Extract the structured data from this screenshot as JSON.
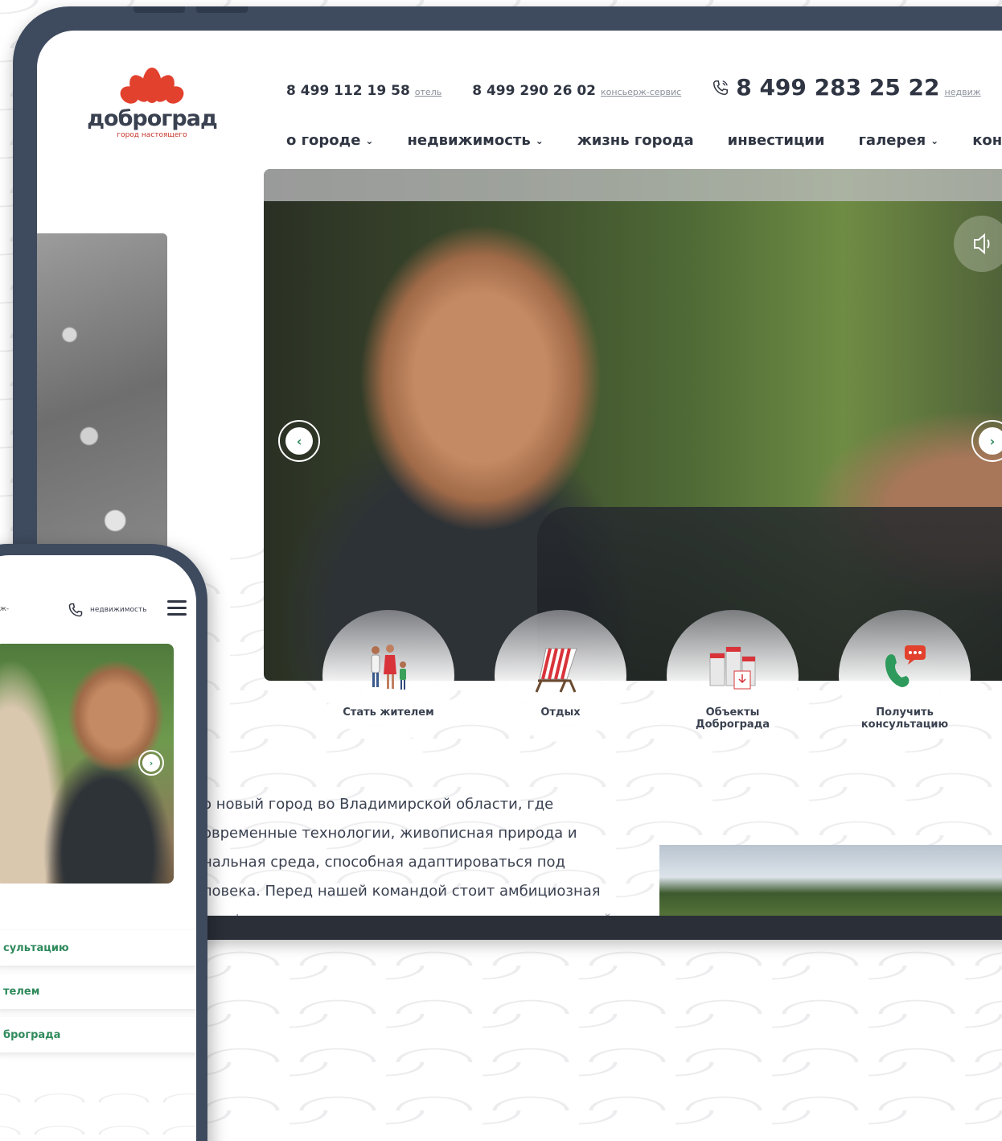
{
  "brand": {
    "name": "доброград",
    "tagline": "город настоящего",
    "accent": "#e2412e",
    "green": "#2f8a5c"
  },
  "header": {
    "phones": [
      {
        "number": "8 499 112 19 58",
        "label": "отель"
      },
      {
        "number": "8 499 290 26 02",
        "label": "консьерж-сервис"
      }
    ],
    "main_phone": {
      "number": "8 499 283 25 22",
      "label": "недвиж",
      "icon": "phone-icon"
    }
  },
  "nav": {
    "items": [
      {
        "label": "о городе",
        "dropdown": true
      },
      {
        "label": "недвижимость",
        "dropdown": true
      },
      {
        "label": "жизнь города",
        "dropdown": false
      },
      {
        "label": "инвестиции",
        "dropdown": false
      },
      {
        "label": "галерея",
        "dropdown": true
      },
      {
        "label": "кон",
        "dropdown": false
      }
    ],
    "chevron": "⌄"
  },
  "hero": {
    "prev_icon": "‹",
    "next_icon": "›",
    "sound_icon": "speaker-icon"
  },
  "quick_links": [
    {
      "label": "Стать жителем",
      "icon": "family-icon"
    },
    {
      "label": "Отдых",
      "icon": "deck-chair-icon"
    },
    {
      "label": "Объекты\nДоброграда",
      "icon": "buildings-icon"
    },
    {
      "label": "Получить\nконсультацию",
      "icon": "phone-chat-icon"
    }
  ],
  "about": {
    "lines": [
      "о новый город во Владимирской области, где",
      "овременные технологии, живописная природа и",
      "нальная среда, способная адаптироваться под",
      "ловека. Перед нашей командой стоит амбициозная",
      "комфортность жизни здесь для всех трех поколений"
    ]
  },
  "mobile": {
    "concierge_label": "рж-",
    "concierge_label2": "",
    "call_label": "недвижимость",
    "next_icon": "›",
    "buttons": [
      "сультацию",
      "телем",
      "брограда"
    ]
  }
}
